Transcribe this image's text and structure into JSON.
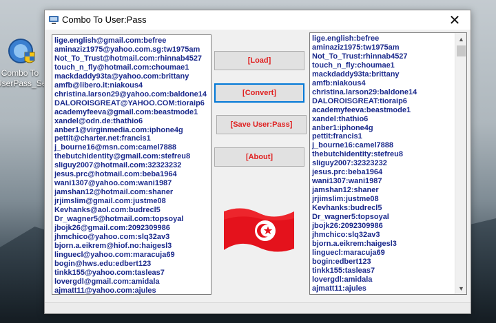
{
  "desktop": {
    "icon_label": "Combo To UserPass_Setup"
  },
  "window": {
    "title": "Combo To User:Pass",
    "close_glyph": "✕"
  },
  "buttons": {
    "load": "[Load]",
    "convert": "[Convert]",
    "save": "[Save User:Pass]",
    "about": "[About]"
  },
  "flag": {
    "icon": "tunisian-flag-icon",
    "colors": {
      "red": "#e4121c",
      "white": "#ffffff"
    }
  },
  "left_list": [
    "lige.english@gmail.com:befree",
    "aminaziz1975@yahoo.com.sg:tw1975am",
    "Not_To_Trust@hotmail.com:rhinnab4527",
    "touch_n_fly@hotmail.com:choumae1",
    "mackdaddy93ta@yahoo.com:brittany",
    "amfb@libero.it:niakous4",
    "christina.larson29@yahoo.com:baldone14",
    "DALOROISGREAT@YAHOO.COM:tioraip6",
    "academyfeeva@gmail.com:beastmode1",
    "xandel@odn.de:thathio6",
    "anber1@virginmedia.com:iphone4g",
    "pettit@charter.net:francis1",
    "j_bourne16@msn.com:camel7888",
    "thebutchidentity@gmail.com:stefreu8",
    "sliguy2007@hotmail.com:32323232",
    "jesus.prc@hotmail.com:beba1964",
    "wani1307@yahoo.com:wani1987",
    "jamshan12@hotmail.com:shaner",
    "jrjimslim@gmail.com:justme08",
    "Kevhanks@aol.com:budrecl5",
    "Dr_wagner5@hotmail.com:topsoyal",
    "jbojk26@gmail.com:2092309986",
    "jhmchico@yahoo.com:slq32av3",
    "bjorn.a.eikrem@hiof.no:haigesl3",
    "linguecl@yahoo.com:maracuja69",
    "bogin@hws.edu:edbert123",
    "tinkk155@yahoo.com:tasleas7",
    "lovergdl@gmail.com:amidala",
    "ajmatt11@yahoo.com:ajules"
  ],
  "right_list": [
    "lige.english:befree",
    "aminaziz1975:tw1975am",
    "Not_To_Trust:rhinnab4527",
    "touch_n_fly:choumae1",
    "mackdaddy93ta:brittany",
    "amfb:niakous4",
    "christina.larson29:baldone14",
    "DALOROISGREAT:tioraip6",
    "academyfeeva:beastmode1",
    "xandel:thathio6",
    "anber1:iphone4g",
    "pettit:francis1",
    "j_bourne16:camel7888",
    "thebutchidentity:stefreu8",
    "sliguy2007:32323232",
    "jesus.prc:beba1964",
    "wani1307:wani1987",
    "jamshan12:shaner",
    "jrjimslim:justme08",
    "Kevhanks:budrecl5",
    "Dr_wagner5:topsoyal",
    "jbojk26:2092309986",
    "jhmchico:slq32av3",
    "bjorn.a.eikrem:haigesl3",
    "linguecl:maracuja69",
    "bogin:edbert123",
    "tinkk155:tasleas7",
    "lovergdl:amidala",
    "ajmatt11:ajules"
  ],
  "scrollbar": {
    "up": "▲",
    "down": "▼"
  }
}
